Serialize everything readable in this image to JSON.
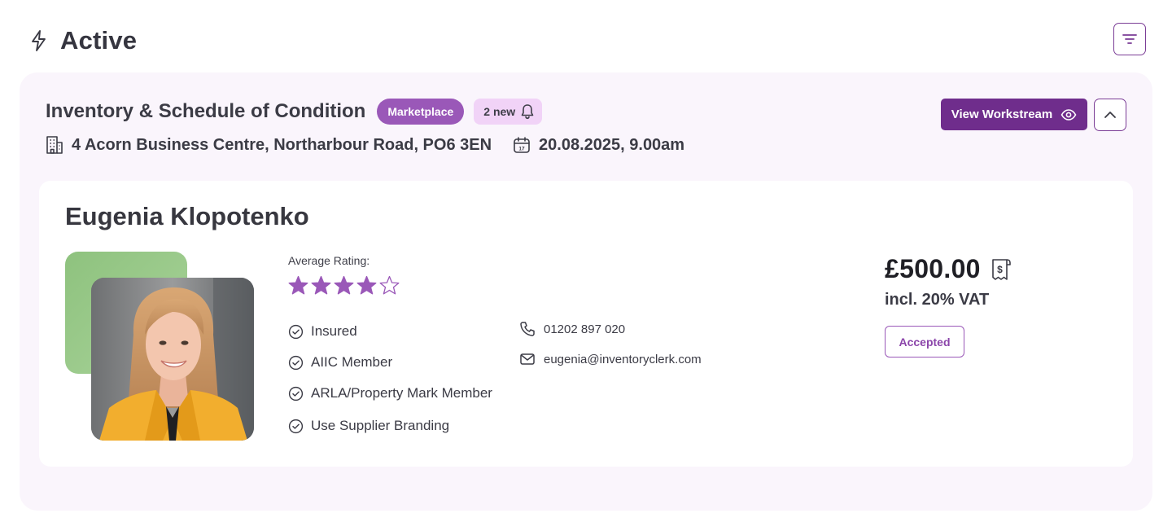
{
  "header": {
    "title": "Active",
    "title_icon": "lightning-bolt-icon",
    "filter_icon": "filter-lines-icon"
  },
  "workstream": {
    "title": "Inventory & Schedule of Condition",
    "marketplace_badge": "Marketplace",
    "new_badge": "2 new",
    "address": "4 Acorn Business Centre, Northarbour Road, PO6 3EN",
    "datetime": "20.08.2025, 9.00am",
    "calendar_day": "17",
    "view_button_label": "View Workstream"
  },
  "supplier": {
    "name": "Eugenia Klopotenko",
    "rating_label": "Average Rating:",
    "rating": 4,
    "rating_max": 5,
    "features": [
      "Insured",
      "AIIC Member",
      "ARLA/Property Mark Member",
      "Use Supplier Branding"
    ],
    "phone": "01202 897 020",
    "email": "eugenia@inventoryclerk.com",
    "price": "£500.00",
    "vat": "incl. 20% VAT",
    "receipt_symbol": "$",
    "status": "Accepted"
  },
  "colors": {
    "brand_purple": "#6f2d8c",
    "accent_purple": "#9a58b8",
    "card_background": "#faf5fc",
    "badge_pink": "#f1d3f7",
    "photo_accent_green": "#8ec27e",
    "star_fill": "#9a58b8"
  }
}
